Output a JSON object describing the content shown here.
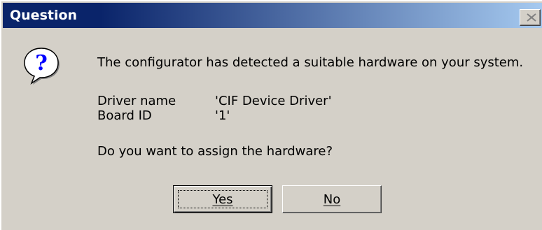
{
  "dialog": {
    "title": "Question",
    "icon": "question-icon",
    "message": "The configurator has detected a suitable hardware on your system.",
    "details": [
      {
        "label": "Driver name",
        "value": "'CIF Device Driver'"
      },
      {
        "label": "Board ID",
        "value": "'1'"
      }
    ],
    "prompt": "Do you want to assign the hardware?",
    "buttons": {
      "yes_label": "Yes",
      "no_label": "No"
    },
    "colors": {
      "titlebar_start": "#0a246a",
      "titlebar_end": "#a6caf0",
      "face": "#d4d0c8"
    }
  }
}
